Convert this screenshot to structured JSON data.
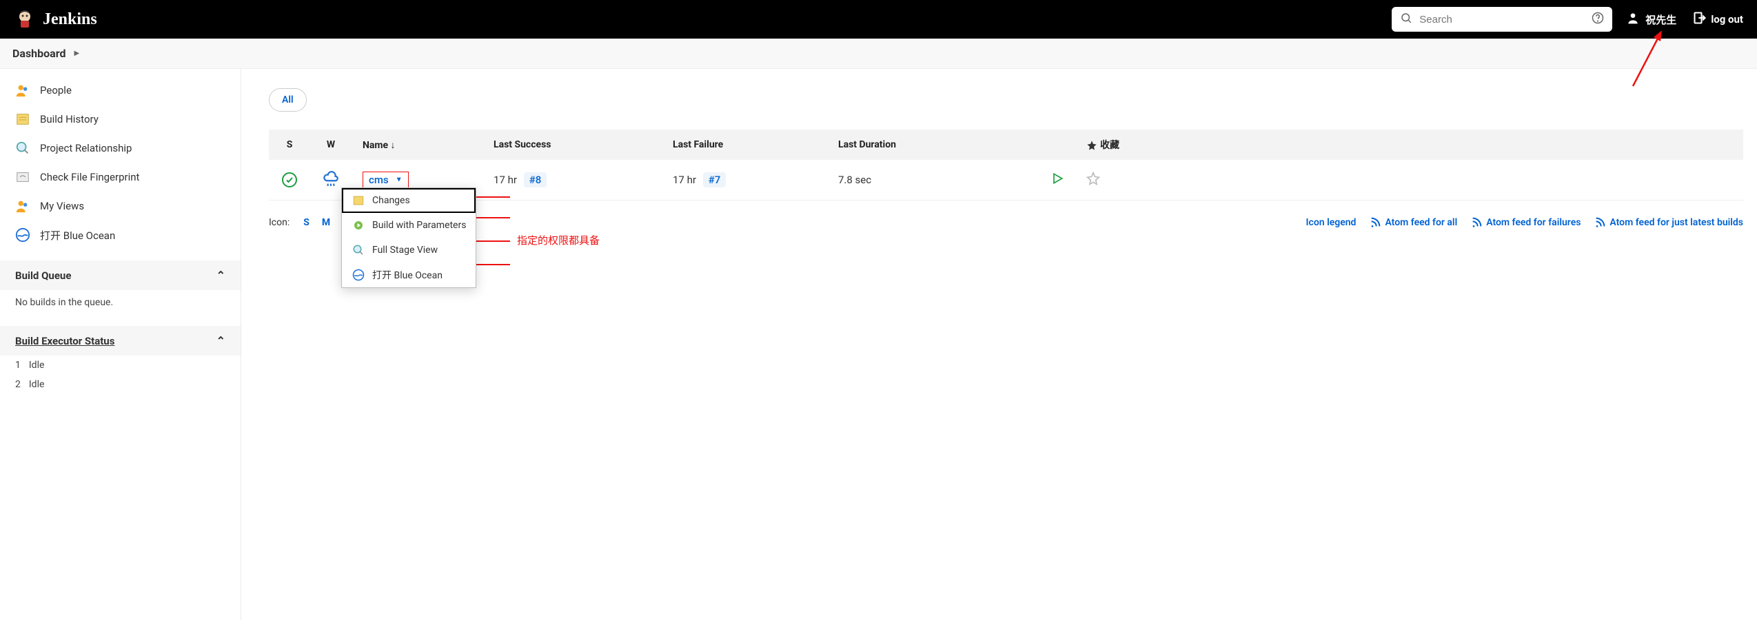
{
  "header": {
    "brand": "Jenkins",
    "search_placeholder": "Search",
    "username": "祝先生",
    "logout": "log out"
  },
  "breadcrumb": {
    "item": "Dashboard"
  },
  "sidebar": {
    "nav": [
      {
        "label": "People"
      },
      {
        "label": "Build History"
      },
      {
        "label": "Project Relationship"
      },
      {
        "label": "Check File Fingerprint"
      },
      {
        "label": "My Views"
      },
      {
        "label": "打开 Blue Ocean"
      }
    ],
    "build_queue": {
      "title": "Build Queue",
      "empty": "No builds in the queue."
    },
    "executor": {
      "title": "Build Executor Status",
      "rows": [
        {
          "num": "1",
          "state": "Idle"
        },
        {
          "num": "2",
          "state": "Idle"
        }
      ]
    }
  },
  "content": {
    "tab_all": "All",
    "columns": {
      "s": "S",
      "w": "W",
      "name": "Name",
      "last_success": "Last Success",
      "last_failure": "Last Failure",
      "last_duration": "Last Duration",
      "fav": "收藏"
    },
    "row": {
      "name": "cms",
      "last_success_time": "17 hr",
      "last_success_build": "#8",
      "last_failure_time": "17 hr",
      "last_failure_build": "#7",
      "last_duration": "7.8 sec"
    },
    "dropdown": {
      "changes": "Changes",
      "build_params": "Build with Parameters",
      "full_stage": "Full Stage View",
      "blue_ocean": "打开 Blue Ocean"
    },
    "footer": {
      "icon_label": "Icon:",
      "size_s": "S",
      "size_m": "M",
      "icon_legend": "Icon legend",
      "atom_all": "Atom feed for all",
      "atom_fail": "Atom feed for failures",
      "atom_latest": "Atom feed for just latest builds"
    }
  },
  "annotation": {
    "text": "指定的权限都具备"
  }
}
